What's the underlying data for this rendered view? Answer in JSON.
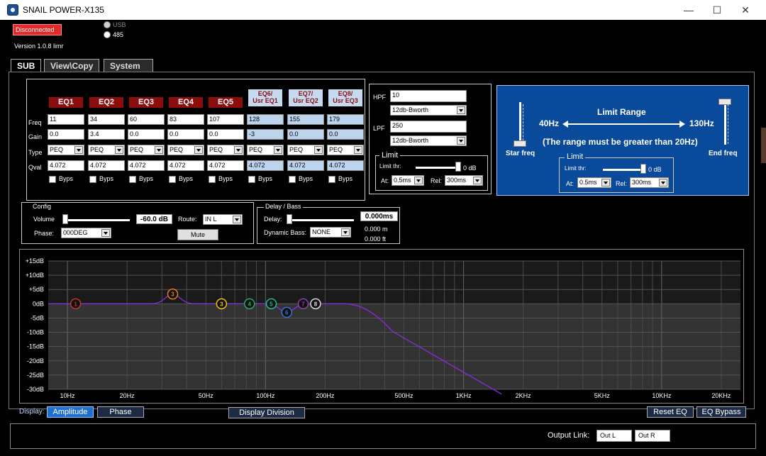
{
  "window": {
    "title": "SNAIL POWER-X135",
    "minimize": "—",
    "maximize": "☐",
    "close": "✕"
  },
  "status": {
    "disconnected": "Disconnected",
    "usb": "USB",
    "r485": "485",
    "version": "Version 1.0.8 limr"
  },
  "tabs": [
    "SUB",
    "View\\Copy",
    "System"
  ],
  "eq": {
    "row_labels": [
      "Freq",
      "Gain",
      "Type",
      "Qval"
    ],
    "bypass_label": "Byps",
    "bands": [
      {
        "name": "EQ1",
        "freq": "11",
        "gain": "0.0",
        "type": "PEQ",
        "q": "4.072"
      },
      {
        "name": "EQ2",
        "freq": "34",
        "gain": "3.4",
        "type": "PEQ",
        "q": "4.072"
      },
      {
        "name": "EQ3",
        "freq": "60",
        "gain": "0.0",
        "type": "PEQ",
        "q": "4.072"
      },
      {
        "name": "EQ4",
        "freq": "83",
        "gain": "0.0",
        "type": "PEQ",
        "q": "4.072"
      },
      {
        "name": "EQ5",
        "freq": "107",
        "gain": "0.0",
        "type": "PEQ",
        "q": "4.072"
      },
      {
        "name": "EQ6/\nUsr EQ1",
        "freq": "128",
        "gain": "-3",
        "type": "PEQ",
        "q": "4.072"
      },
      {
        "name": "EQ7/\nUsr EQ2",
        "freq": "155",
        "gain": "0.0",
        "type": "PEQ",
        "q": "4.072"
      },
      {
        "name": "EQ8/\nUsr EQ3",
        "freq": "179",
        "gain": "0.0",
        "type": "PEQ",
        "q": "4.072"
      }
    ]
  },
  "filters": {
    "hpf_label": "HPF",
    "hpf_value": "10",
    "hpf_type": "12db-Bworth",
    "lpf_label": "LPF",
    "lpf_value": "250",
    "lpf_type": "12db-Bworth"
  },
  "limit_small": {
    "title": "Limit",
    "thr_label": "Limit thr:",
    "thr_value": "0 dB",
    "at_label": "At:",
    "at_value": "0.5ms",
    "rel_label": "Rel:",
    "rel_value": "300ms"
  },
  "limit_range": {
    "title": "Limit Range",
    "left_freq": "40Hz",
    "right_freq": "130Hz",
    "note": "(The range must be greater than 20Hz)",
    "start_label": "Star freq",
    "end_label": "End freq",
    "limit_title": "Limit",
    "thr_label": "Limit thr:",
    "thr_value": "0 dB",
    "at_label": "At:",
    "at_value": "0.5ms",
    "rel_label": "Rel:",
    "rel_value": "300ms",
    "bg_color": "#0a4a9a"
  },
  "config": {
    "title": "Config",
    "volume_label": "Volume",
    "volume_value": "-60.0 dB",
    "route_label": "Route:",
    "route_value": "IN L",
    "phase_label": "Phase:",
    "phase_value": "000DEG",
    "mute_label": "Mute"
  },
  "delay": {
    "title": "Delay / Bass",
    "delay_label": "Delay:",
    "delay_value": "0.000ms",
    "meters": "0.000 m",
    "feet": "0.000 ft",
    "bass_label": "Dynamic Bass:",
    "bass_value": "NONE"
  },
  "graph": {
    "y_labels": [
      "+15dB",
      "+10dB",
      "+5dB",
      "0dB",
      "-5dB",
      "-10dB",
      "-15dB",
      "-20dB",
      "-25dB",
      "-30dB"
    ],
    "x_labels": [
      "10Hz",
      "20Hz",
      "50Hz",
      "100Hz",
      "200Hz",
      "500Hz",
      "1KHz",
      "2KHz",
      "5KHz",
      "10KHz",
      "20KHz"
    ],
    "x_values": [
      10,
      20,
      50,
      100,
      200,
      500,
      1000,
      2000,
      5000,
      10000,
      20000
    ],
    "y_range": [
      -30,
      15
    ],
    "x_range": [
      8,
      25000
    ],
    "curve_color": "#8a2be2",
    "markers": [
      {
        "label": "1",
        "freq": 11,
        "gain": 0,
        "color": "#c0392b"
      },
      {
        "label": "3",
        "freq": 34,
        "gain": 3.4,
        "color": "#e67e22"
      },
      {
        "label": "3",
        "freq": 60,
        "gain": 0,
        "color": "#f1c40f"
      },
      {
        "label": "4",
        "freq": 83,
        "gain": 0,
        "color": "#27ae60"
      },
      {
        "label": "5",
        "freq": 107,
        "gain": 0,
        "color": "#1abc9c"
      },
      {
        "label": "6",
        "freq": 128,
        "gain": -3,
        "color": "#3b6fd8"
      },
      {
        "label": "7",
        "freq": 155,
        "gain": 0,
        "color": "#8e44ad"
      },
      {
        "label": "8",
        "freq": 179,
        "gain": 0,
        "color": "#dddddd"
      }
    ]
  },
  "display": {
    "label": "Display:",
    "amplitude": "Amplitude",
    "phase": "Phase",
    "division": "Display Division",
    "reset": "Reset EQ",
    "bypass": "EQ Bypass"
  },
  "output": {
    "label": "Output Link:",
    "out_l": "Out L",
    "out_r": "Out R"
  }
}
